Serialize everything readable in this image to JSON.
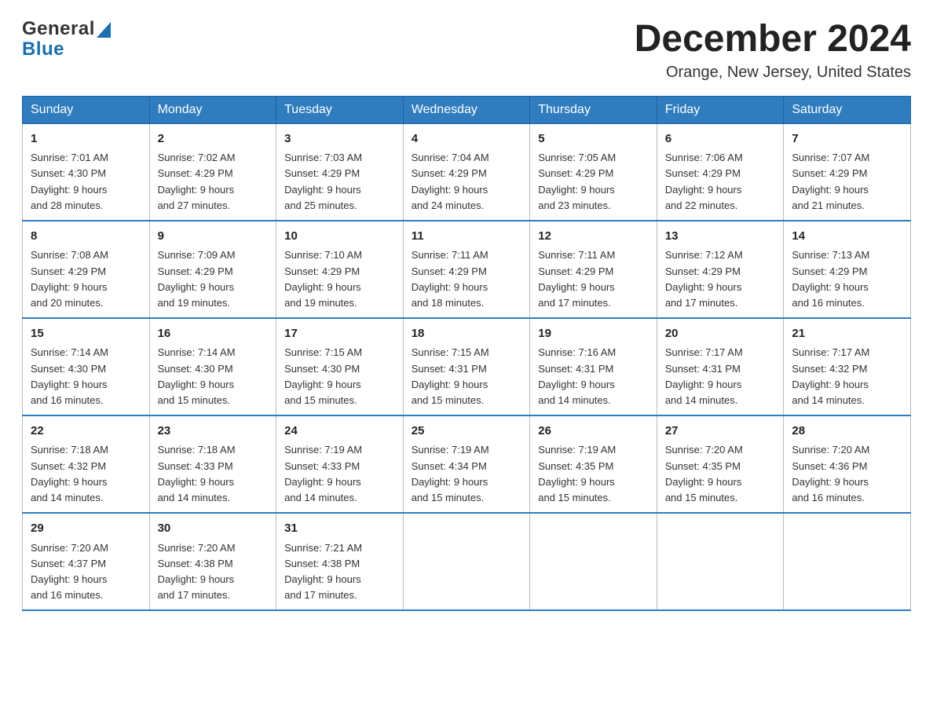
{
  "header": {
    "logo_general": "General",
    "logo_blue": "Blue",
    "title": "December 2024",
    "subtitle": "Orange, New Jersey, United States"
  },
  "weekdays": [
    "Sunday",
    "Monday",
    "Tuesday",
    "Wednesday",
    "Thursday",
    "Friday",
    "Saturday"
  ],
  "weeks": [
    [
      {
        "day": "1",
        "sunrise": "7:01 AM",
        "sunset": "4:30 PM",
        "daylight": "9 hours and 28 minutes."
      },
      {
        "day": "2",
        "sunrise": "7:02 AM",
        "sunset": "4:29 PM",
        "daylight": "9 hours and 27 minutes."
      },
      {
        "day": "3",
        "sunrise": "7:03 AM",
        "sunset": "4:29 PM",
        "daylight": "9 hours and 25 minutes."
      },
      {
        "day": "4",
        "sunrise": "7:04 AM",
        "sunset": "4:29 PM",
        "daylight": "9 hours and 24 minutes."
      },
      {
        "day": "5",
        "sunrise": "7:05 AM",
        "sunset": "4:29 PM",
        "daylight": "9 hours and 23 minutes."
      },
      {
        "day": "6",
        "sunrise": "7:06 AM",
        "sunset": "4:29 PM",
        "daylight": "9 hours and 22 minutes."
      },
      {
        "day": "7",
        "sunrise": "7:07 AM",
        "sunset": "4:29 PM",
        "daylight": "9 hours and 21 minutes."
      }
    ],
    [
      {
        "day": "8",
        "sunrise": "7:08 AM",
        "sunset": "4:29 PM",
        "daylight": "9 hours and 20 minutes."
      },
      {
        "day": "9",
        "sunrise": "7:09 AM",
        "sunset": "4:29 PM",
        "daylight": "9 hours and 19 minutes."
      },
      {
        "day": "10",
        "sunrise": "7:10 AM",
        "sunset": "4:29 PM",
        "daylight": "9 hours and 19 minutes."
      },
      {
        "day": "11",
        "sunrise": "7:11 AM",
        "sunset": "4:29 PM",
        "daylight": "9 hours and 18 minutes."
      },
      {
        "day": "12",
        "sunrise": "7:11 AM",
        "sunset": "4:29 PM",
        "daylight": "9 hours and 17 minutes."
      },
      {
        "day": "13",
        "sunrise": "7:12 AM",
        "sunset": "4:29 PM",
        "daylight": "9 hours and 17 minutes."
      },
      {
        "day": "14",
        "sunrise": "7:13 AM",
        "sunset": "4:29 PM",
        "daylight": "9 hours and 16 minutes."
      }
    ],
    [
      {
        "day": "15",
        "sunrise": "7:14 AM",
        "sunset": "4:30 PM",
        "daylight": "9 hours and 16 minutes."
      },
      {
        "day": "16",
        "sunrise": "7:14 AM",
        "sunset": "4:30 PM",
        "daylight": "9 hours and 15 minutes."
      },
      {
        "day": "17",
        "sunrise": "7:15 AM",
        "sunset": "4:30 PM",
        "daylight": "9 hours and 15 minutes."
      },
      {
        "day": "18",
        "sunrise": "7:15 AM",
        "sunset": "4:31 PM",
        "daylight": "9 hours and 15 minutes."
      },
      {
        "day": "19",
        "sunrise": "7:16 AM",
        "sunset": "4:31 PM",
        "daylight": "9 hours and 14 minutes."
      },
      {
        "day": "20",
        "sunrise": "7:17 AM",
        "sunset": "4:31 PM",
        "daylight": "9 hours and 14 minutes."
      },
      {
        "day": "21",
        "sunrise": "7:17 AM",
        "sunset": "4:32 PM",
        "daylight": "9 hours and 14 minutes."
      }
    ],
    [
      {
        "day": "22",
        "sunrise": "7:18 AM",
        "sunset": "4:32 PM",
        "daylight": "9 hours and 14 minutes."
      },
      {
        "day": "23",
        "sunrise": "7:18 AM",
        "sunset": "4:33 PM",
        "daylight": "9 hours and 14 minutes."
      },
      {
        "day": "24",
        "sunrise": "7:19 AM",
        "sunset": "4:33 PM",
        "daylight": "9 hours and 14 minutes."
      },
      {
        "day": "25",
        "sunrise": "7:19 AM",
        "sunset": "4:34 PM",
        "daylight": "9 hours and 15 minutes."
      },
      {
        "day": "26",
        "sunrise": "7:19 AM",
        "sunset": "4:35 PM",
        "daylight": "9 hours and 15 minutes."
      },
      {
        "day": "27",
        "sunrise": "7:20 AM",
        "sunset": "4:35 PM",
        "daylight": "9 hours and 15 minutes."
      },
      {
        "day": "28",
        "sunrise": "7:20 AM",
        "sunset": "4:36 PM",
        "daylight": "9 hours and 16 minutes."
      }
    ],
    [
      {
        "day": "29",
        "sunrise": "7:20 AM",
        "sunset": "4:37 PM",
        "daylight": "9 hours and 16 minutes."
      },
      {
        "day": "30",
        "sunrise": "7:20 AM",
        "sunset": "4:38 PM",
        "daylight": "9 hours and 17 minutes."
      },
      {
        "day": "31",
        "sunrise": "7:21 AM",
        "sunset": "4:38 PM",
        "daylight": "9 hours and 17 minutes."
      },
      {
        "day": "",
        "sunrise": "",
        "sunset": "",
        "daylight": ""
      },
      {
        "day": "",
        "sunrise": "",
        "sunset": "",
        "daylight": ""
      },
      {
        "day": "",
        "sunrise": "",
        "sunset": "",
        "daylight": ""
      },
      {
        "day": "",
        "sunrise": "",
        "sunset": "",
        "daylight": ""
      }
    ]
  ],
  "labels": {
    "sunrise": "Sunrise:",
    "sunset": "Sunset:",
    "daylight": "Daylight:"
  }
}
